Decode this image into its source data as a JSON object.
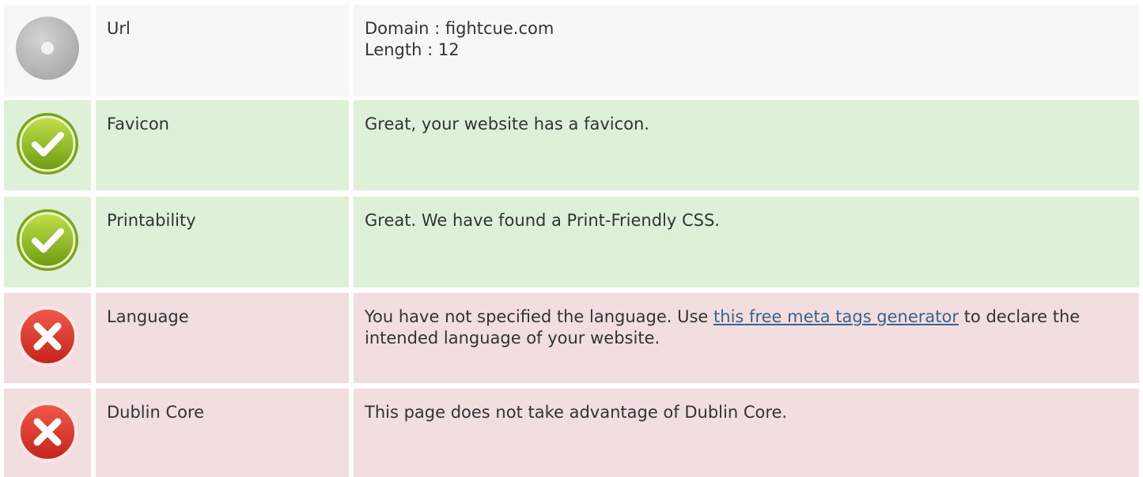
{
  "colors": {
    "neutral_bg": "#f7f7f7",
    "pass_bg": "#dff0d8",
    "fail_bg": "#f2dede",
    "link": "#39638d"
  },
  "rows": [
    {
      "status": "neutral",
      "icon": "neutral-dot-icon",
      "label": "Url",
      "lines": [
        "Domain : fightcue.com",
        "Length : 12"
      ]
    },
    {
      "status": "pass",
      "icon": "checkmark-icon",
      "label": "Favicon",
      "text": "Great, your website has a favicon."
    },
    {
      "status": "pass",
      "icon": "checkmark-icon",
      "label": "Printability",
      "text": "Great. We have found a Print-Friendly CSS."
    },
    {
      "status": "fail",
      "icon": "cross-icon",
      "label": "Language",
      "text_before": "You have not specified the language. Use ",
      "link_text": "this free meta tags generator",
      "text_after": " to declare the intended language of your website."
    },
    {
      "status": "fail",
      "icon": "cross-icon",
      "label": "Dublin Core",
      "text": "This page does not take advantage of Dublin Core."
    }
  ]
}
